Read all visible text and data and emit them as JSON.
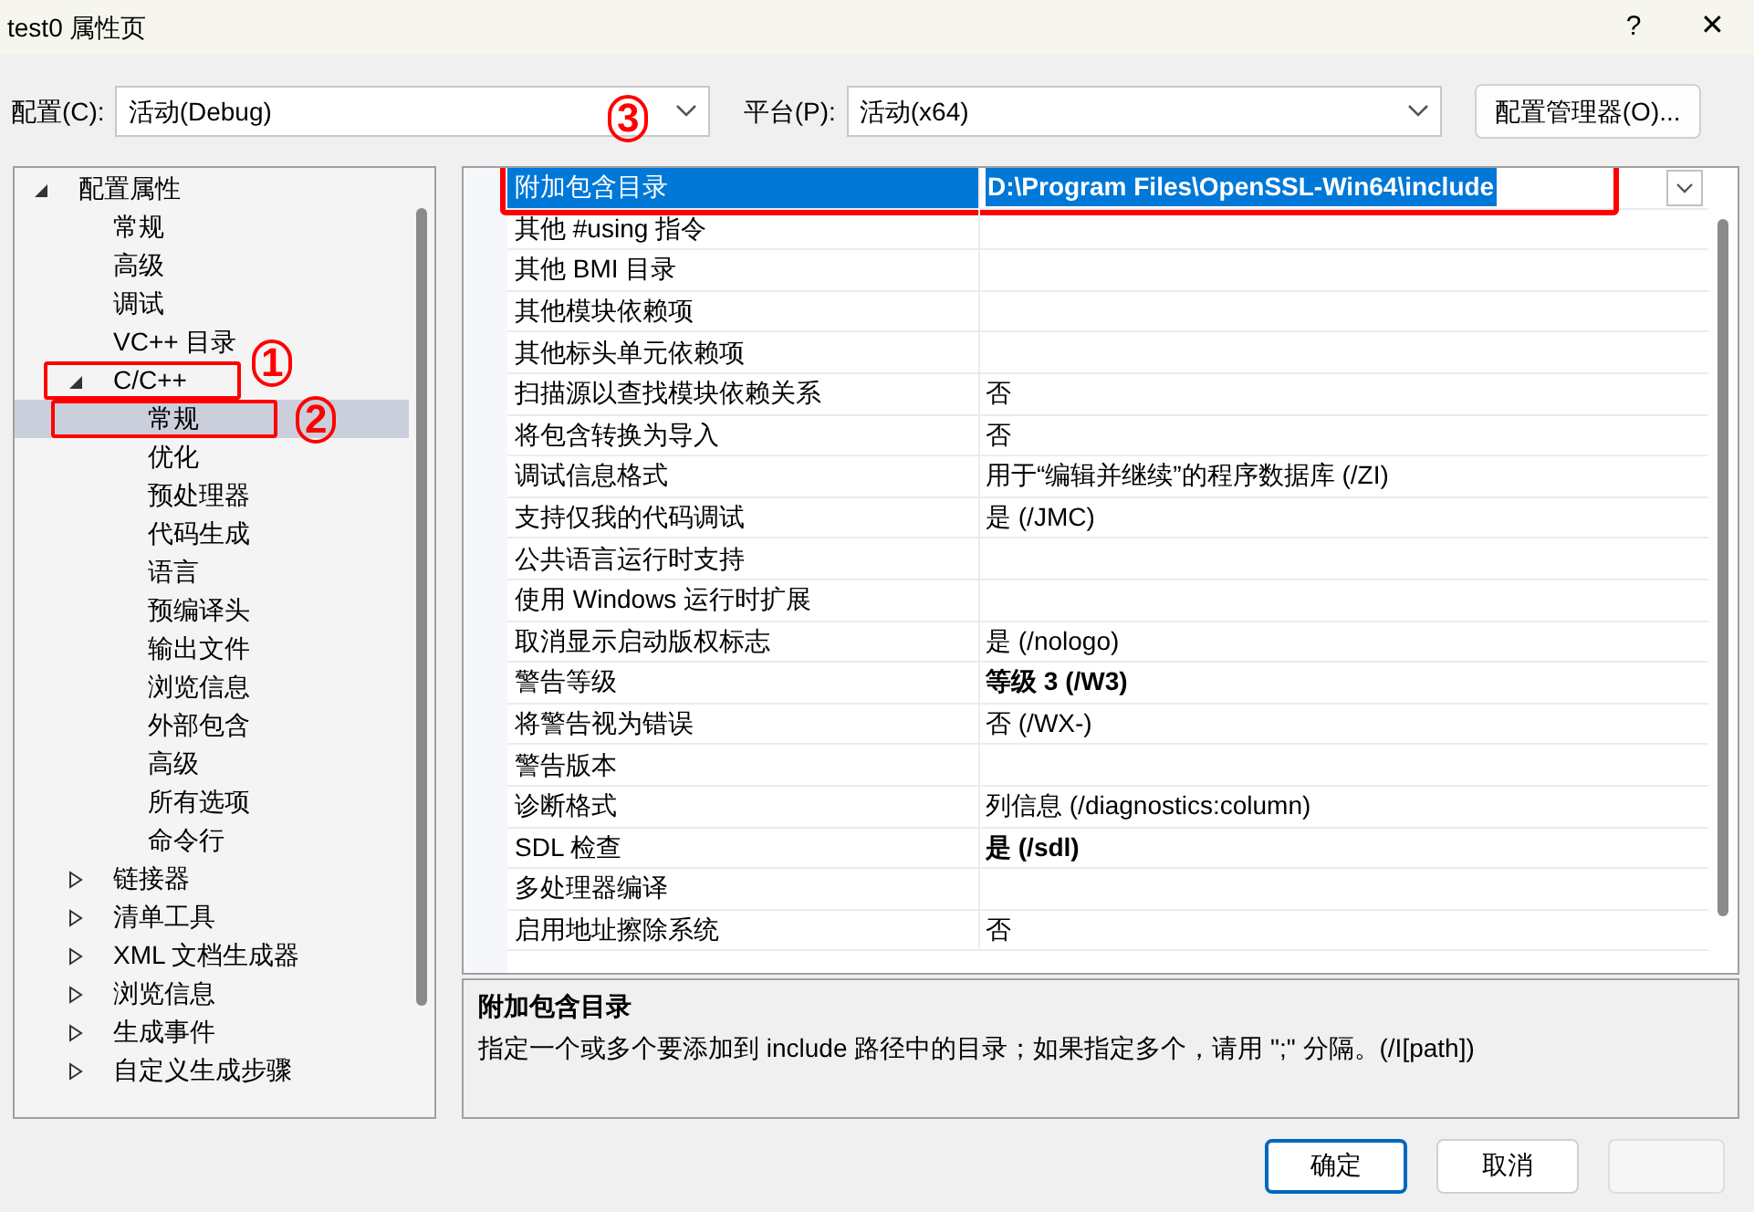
{
  "window": {
    "title": "test0 属性页",
    "help": "?",
    "close": "✕"
  },
  "config_bar": {
    "config_label": "配置(C):",
    "config_value": "活动(Debug)",
    "platform_label": "平台(P):",
    "platform_value": "活动(x64)",
    "manager_button": "配置管理器(O)..."
  },
  "tree": [
    {
      "label": "配置属性",
      "expanded": true,
      "selected": false,
      "children": [
        {
          "label": "常规",
          "selected": false
        },
        {
          "label": "高级",
          "selected": false
        },
        {
          "label": "调试",
          "selected": false
        },
        {
          "label": "VC++ 目录",
          "selected": false
        },
        {
          "label": "C/C++",
          "expanded": true,
          "selected": false,
          "children": [
            {
              "label": "常规",
              "selected": true
            },
            {
              "label": "优化",
              "selected": false
            },
            {
              "label": "预处理器",
              "selected": false
            },
            {
              "label": "代码生成",
              "selected": false
            },
            {
              "label": "语言",
              "selected": false
            },
            {
              "label": "预编译头",
              "selected": false
            },
            {
              "label": "输出文件",
              "selected": false
            },
            {
              "label": "浏览信息",
              "selected": false
            },
            {
              "label": "外部包含",
              "selected": false
            },
            {
              "label": "高级",
              "selected": false
            },
            {
              "label": "所有选项",
              "selected": false
            },
            {
              "label": "命令行",
              "selected": false
            }
          ]
        },
        {
          "label": "链接器",
          "expanded": false,
          "selected": false
        },
        {
          "label": "清单工具",
          "expanded": false,
          "selected": false
        },
        {
          "label": "XML 文档生成器",
          "expanded": false,
          "selected": false
        },
        {
          "label": "浏览信息",
          "expanded": false,
          "selected": false
        },
        {
          "label": "生成事件",
          "expanded": false,
          "selected": false
        },
        {
          "label": "自定义生成步骤",
          "expanded": false,
          "selected": false
        }
      ]
    }
  ],
  "properties": [
    {
      "name": "附加包含目录",
      "value": "D:\\Program Files\\OpenSSL-Win64\\include",
      "bold": true,
      "selected": true
    },
    {
      "name": "其他 #using 指令",
      "selected": false
    },
    {
      "name": "其他 BMI 目录",
      "selected": false
    },
    {
      "name": "其他模块依赖项",
      "selected": false
    },
    {
      "name": "其他标头单元依赖项",
      "selected": false
    },
    {
      "name": "扫描源以查找模块依赖关系",
      "value": "否",
      "bold": false,
      "selected": false
    },
    {
      "name": "将包含转换为导入",
      "value": "否",
      "bold": false,
      "selected": false
    },
    {
      "name": "调试信息格式",
      "value": "用于“编辑并继续”的程序数据库 (/ZI)",
      "bold": false,
      "selected": false
    },
    {
      "name": "支持仅我的代码调试",
      "value": "是 (/JMC)",
      "bold": false,
      "selected": false
    },
    {
      "name": "公共语言运行时支持",
      "selected": false
    },
    {
      "name": "使用 Windows 运行时扩展",
      "selected": false
    },
    {
      "name": "取消显示启动版权标志",
      "value": "是 (/nologo)",
      "bold": false,
      "selected": false
    },
    {
      "name": "警告等级",
      "value": "等级 3 (/W3)",
      "bold": true,
      "selected": false
    },
    {
      "name": "将警告视为错误",
      "value": "否 (/WX-)",
      "bold": false,
      "selected": false
    },
    {
      "name": "警告版本",
      "selected": false
    },
    {
      "name": "诊断格式",
      "value": "列信息 (/diagnostics:column)",
      "bold": false,
      "selected": false
    },
    {
      "name": "SDL 检查",
      "value": "是 (/sdl)",
      "bold": true,
      "selected": false
    },
    {
      "name": "多处理器编译",
      "selected": false
    },
    {
      "name": "启用地址擦除系统",
      "value": "否",
      "bold": false,
      "selected": false
    }
  ],
  "description": {
    "title": "附加包含目录",
    "text": "指定一个或多个要添加到 include 路径中的目录；如果指定多个，请用 \";\" 分隔。(/I[path])"
  },
  "buttons": [
    {
      "label": "确定",
      "kind": "default"
    },
    {
      "label": "取消",
      "kind": "normal"
    }
  ],
  "annotations": [
    "1",
    "2",
    "3"
  ]
}
